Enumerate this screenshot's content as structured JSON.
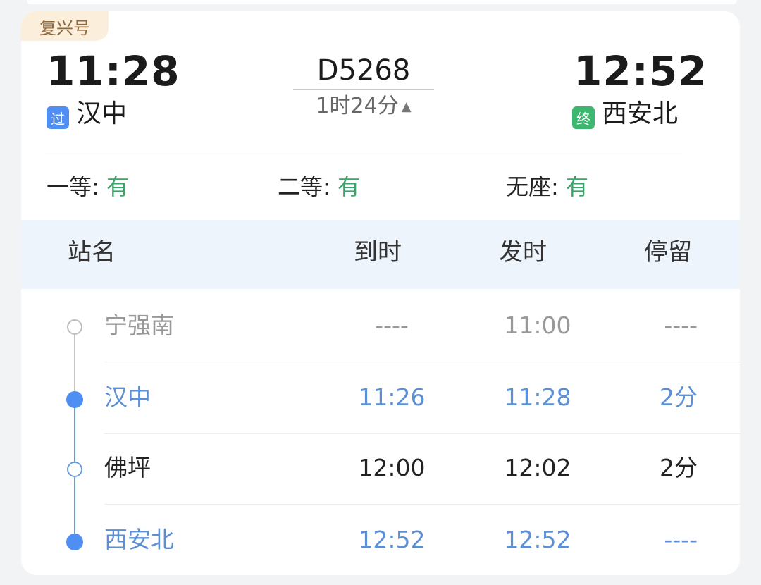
{
  "train": {
    "badge": "复兴号",
    "number": "D5268",
    "duration": "1时24分",
    "departure": {
      "time": "11:28",
      "tag": "过",
      "station": "汉中"
    },
    "arrival": {
      "time": "12:52",
      "tag": "终",
      "station": "西安北"
    }
  },
  "seats": [
    {
      "label": "一等: ",
      "status": "有"
    },
    {
      "label": "二等: ",
      "status": "有"
    },
    {
      "label": "无座: ",
      "status": "有"
    }
  ],
  "table": {
    "headers": {
      "name": "站名",
      "arrive": "到时",
      "depart": "发时",
      "stop": "停留"
    },
    "rows": [
      {
        "name": "宁强南",
        "arrive": "----",
        "depart": "11:00",
        "stop": "----"
      },
      {
        "name": "汉中",
        "arrive": "11:26",
        "depart": "11:28",
        "stop": "2分"
      },
      {
        "name": "佛坪",
        "arrive": "12:00",
        "depart": "12:02",
        "stop": "2分"
      },
      {
        "name": "西安北",
        "arrive": "12:52",
        "depart": "12:52",
        "stop": "----"
      }
    ]
  },
  "colors": {
    "accent_blue": "#4f8ef2",
    "available_green": "#3aa56a",
    "badge_bg": "#fbeedb"
  },
  "icons": {
    "duration_toggle": "triangle-up-icon"
  }
}
